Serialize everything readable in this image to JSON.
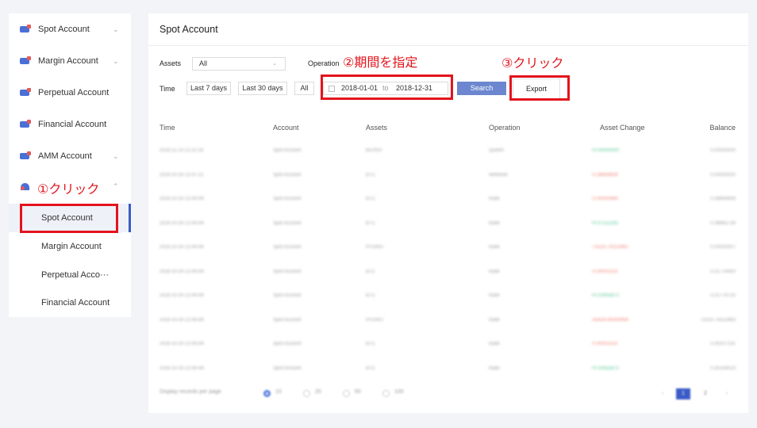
{
  "sidebar": {
    "items": [
      {
        "label": "Spot Account",
        "chevron": "⌄"
      },
      {
        "label": "Margin Account",
        "chevron": "⌄"
      },
      {
        "label": "Perpetual Account"
      },
      {
        "label": "Financial Account"
      },
      {
        "label": "AMM Account",
        "chevron": "⌄"
      },
      {
        "label": "",
        "chevron": "⌃"
      }
    ],
    "sub_items": [
      "Spot Account",
      "Margin Account",
      "Perpetual Acco···",
      "Financial Account"
    ]
  },
  "main": {
    "title": "Spot Account",
    "filters": {
      "assets_label": "Assets",
      "assets_value": "All",
      "operation_label": "Operation",
      "time_label": "Time",
      "last7": "Last 7 days",
      "last30": "Last 30 days",
      "all": "All",
      "date_from": "2018-01-01",
      "date_to_label": "to",
      "date_to": "2018-12-31",
      "search": "Search",
      "export": "Export"
    },
    "columns": [
      "Time",
      "Account",
      "Assets",
      "Operation",
      "Asset Change",
      "Balance"
    ],
    "rows": [
      [
        "2018-11-13 21:22:16",
        "Spot Account",
        "BCHSV",
        "system",
        "+0.00000000",
        "0.00000000"
      ],
      [
        "2018-10-30 22:47:21",
        "Spot Account",
        "BTC",
        "withdraw",
        "-0.38664808",
        "0.00000000"
      ],
      [
        "2018-10-30 22:44:49",
        "Spot Account",
        "BTC",
        "trade",
        "-0.00000484",
        "0.38664808"
      ],
      [
        "2018-10-30 22:44:49",
        "Spot Account",
        "BTC",
        "trade",
        "+0.07111292",
        "0.38665738"
      ],
      [
        "2018-10-30 22:44:49",
        "Spot Account",
        "HYDRO",
        "trade",
        "-73225.74113462",
        "0.00000007"
      ],
      [
        "2018-10-30 22:44:49",
        "Spot Account",
        "BTC",
        "trade",
        "-0.00001103",
        "0.31776403"
      ],
      [
        "2018-10-30 22:44:49",
        "Spot Account",
        "BTC",
        "trade",
        "+0.01655872",
        "0.31774725"
      ],
      [
        "2018-10-30 22:44:49",
        "Spot Account",
        "HYDRO",
        "trade",
        "-55426.46309494",
        "73225.74113463"
      ],
      [
        "2018-10-30 22:44:49",
        "Spot Account",
        "BTC",
        "trade",
        "-0.00001103",
        "0.30107101"
      ],
      [
        "2018-10-30 22:44:49",
        "Spot Account",
        "BTC",
        "trade",
        "+0.01655872",
        "0.30109023"
      ]
    ],
    "pagination": {
      "per_page_label": "Display records per page",
      "options": [
        "10",
        "20",
        "50",
        "100"
      ],
      "prev": "‹",
      "pages": [
        "1",
        "2"
      ],
      "next": "›"
    }
  },
  "annotations": {
    "step1": "①クリック",
    "step2": "②期間を指定",
    "step3": "③クリック"
  },
  "colors": {
    "accent": "#3a5bc7",
    "search_button": "#6c87cf",
    "annotation": "#e3131c",
    "positive": "#4cc28b",
    "negative": "#ef7a6e"
  }
}
